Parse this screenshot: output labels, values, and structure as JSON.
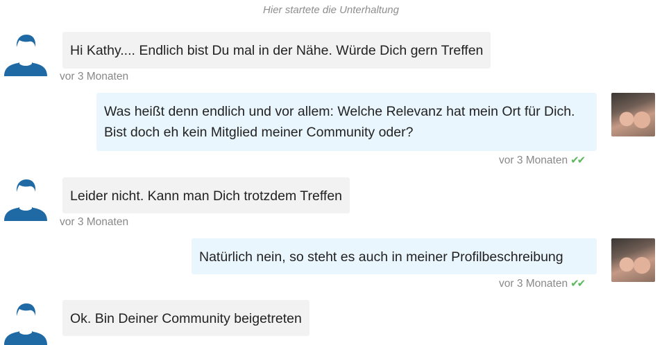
{
  "conversation_start": "Hier startete die Unterhaltung",
  "messages": [
    {
      "text": "Hi Kathy.... Endlich bist Du mal in der Nähe. Würde Dich gern Treffen",
      "time": "vor 3 Monaten"
    },
    {
      "text": "Was heißt denn endlich und vor allem: Welche Relevanz hat mein Ort für Dich. Bist doch eh kein Mitglied meiner Community oder?",
      "time": "vor 3 Monaten"
    },
    {
      "text": "Leider nicht. Kann man Dich trotzdem Treffen",
      "time": "vor 3 Monaten"
    },
    {
      "text": "Natürlich nein, so steht es auch in meiner Profilbeschreibung",
      "time": "vor 3 Monaten"
    },
    {
      "text": "Ok. Bin Deiner Community beigetreten"
    }
  ],
  "icons": {
    "read_receipt": "double-check-icon",
    "default_avatar": "user-silhouette-icon"
  },
  "colors": {
    "incoming_bg": "#f2f2f2",
    "outgoing_bg": "#eaf6fd",
    "avatar_blue": "#1f6aa5",
    "check_green": "#5cb85c"
  }
}
